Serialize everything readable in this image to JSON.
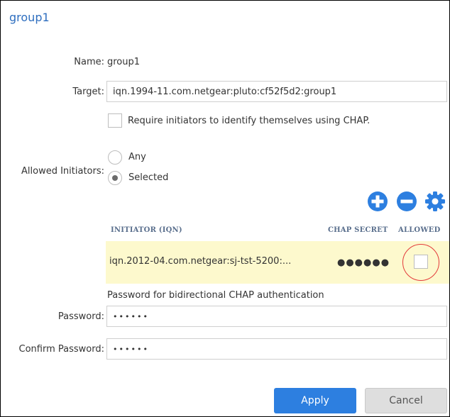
{
  "window": {
    "title": "group1"
  },
  "form": {
    "name_label": "Name:",
    "name_value": "group1",
    "target_label": "Target:",
    "target_value": "iqn.1994-11.com.netgear:pluto:cf52f5d2:group1",
    "chap_checkbox_label": "Require initiators to identify themselves using CHAP.",
    "chap_checked": false,
    "allowed_initiators_label": "Allowed Initiators:",
    "options": [
      {
        "label": "Any",
        "selected": false
      },
      {
        "label": "Selected",
        "selected": true
      }
    ]
  },
  "toolbar": {
    "add_icon": "plus-circle-icon",
    "remove_icon": "minus-circle-icon",
    "settings_icon": "gear-icon",
    "icon_color": "#2d7fe0"
  },
  "table": {
    "columns": [
      "INITIATOR (IQN)",
      "CHAP SECRET",
      "ALLOWED"
    ],
    "rows": [
      {
        "initiator": "iqn.2012-04.com.netgear:sj-tst-5200:...",
        "secret": "●●●●●●",
        "allowed": false
      }
    ],
    "highlight_color": "#fdf9cd"
  },
  "bidirectional": {
    "hint": "Password for bidirectional CHAP authentication",
    "password_label": "Password:",
    "password_value": "••••••",
    "confirm_label": "Confirm Password:",
    "confirm_value": "••••••"
  },
  "buttons": {
    "apply": "Apply",
    "cancel": "Cancel"
  },
  "colors": {
    "accent": "#2d7fe0",
    "title": "#2e6ebf",
    "annotation": "#e33b3b"
  }
}
